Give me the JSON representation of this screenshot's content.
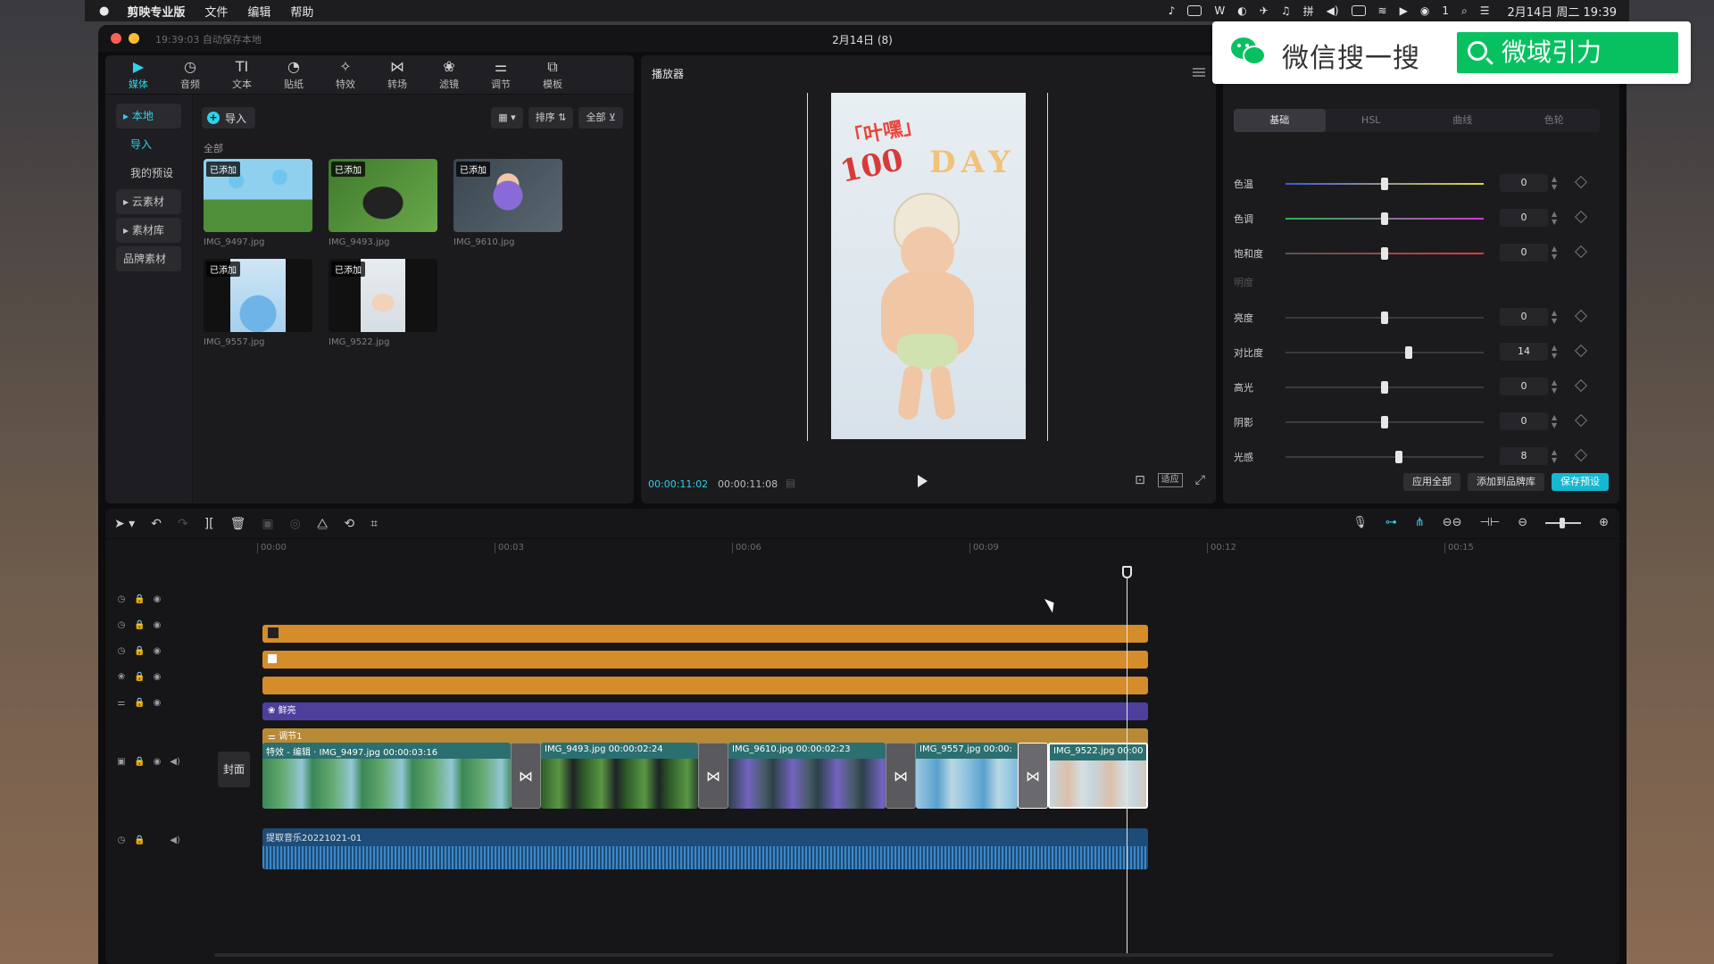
{
  "menubar": {
    "app_name": "剪映专业版",
    "menus": [
      "文件",
      "编辑",
      "帮助"
    ],
    "notif_count": "1",
    "datetime": "2月14日 周二  19:39"
  },
  "window": {
    "autosave": "19:39:03 自动保存本地",
    "title": "2月14日 (8)"
  },
  "toolbar": {
    "items": [
      {
        "label": "媒体",
        "icon": "media-icon"
      },
      {
        "label": "音频",
        "icon": "audio-icon"
      },
      {
        "label": "文本",
        "icon": "text-icon"
      },
      {
        "label": "贴纸",
        "icon": "sticker-icon"
      },
      {
        "label": "特效",
        "icon": "effects-icon"
      },
      {
        "label": "转场",
        "icon": "transition-icon"
      },
      {
        "label": "滤镜",
        "icon": "filter-icon"
      },
      {
        "label": "调节",
        "icon": "adjust-icon"
      },
      {
        "label": "模板",
        "icon": "template-icon"
      }
    ]
  },
  "sidebar": {
    "items": [
      "本地",
      "导入",
      "我的预设",
      "云素材",
      "素材库",
      "品牌素材"
    ]
  },
  "media": {
    "import_label": "导入",
    "sort_label": "排序",
    "filter_label": "全部",
    "section_label": "全部",
    "added_badge": "已添加",
    "files": [
      "IMG_9497.jpg",
      "IMG_9493.jpg",
      "IMG_9610.jpg",
      "IMG_9557.jpg",
      "IMG_9522.jpg"
    ]
  },
  "player": {
    "title": "播放器",
    "current_time": "00:00:11:02",
    "total_time": "00:00:11:08",
    "fit_label": "适应",
    "photo_text_1": "「叶嘿」",
    "photo_text_2": "100",
    "photo_text_3": "DAY"
  },
  "adjust": {
    "tabs": [
      "基础",
      "HSL",
      "曲线",
      "色轮"
    ],
    "sliders": [
      {
        "label": "色温",
        "value": "0",
        "level": 0.5
      },
      {
        "label": "色调",
        "value": "0",
        "level": 0.5
      },
      {
        "label": "饱和度",
        "value": "0",
        "level": 0.5
      },
      {
        "label": "亮度",
        "value": "0",
        "level": 0.5
      },
      {
        "label": "对比度",
        "value": "14",
        "level": 0.62
      },
      {
        "label": "高光",
        "value": "0",
        "level": 0.5
      },
      {
        "label": "阴影",
        "value": "0",
        "level": 0.5
      },
      {
        "label": "光感",
        "value": "8",
        "level": 0.57
      }
    ],
    "section_brightness": "明度",
    "apply_all": "应用全部",
    "add_brand": "添加到品牌库",
    "save_preset": "保存预设"
  },
  "wechat": {
    "search_text": "微信搜一搜",
    "button_text": "微域引力"
  },
  "timeline": {
    "ticks": [
      "00:00",
      "00:03",
      "00:06",
      "00:09",
      "00:12",
      "00:15"
    ],
    "clip_vivid": "鲜亮",
    "clip_adjust": "调节1",
    "cover_label": "封面",
    "video_clips": [
      {
        "label": "特效 - 编辑 · IMG_9497.jpg  00:00:03:16"
      },
      {
        "label": "IMG_9493.jpg  00:00:02:24"
      },
      {
        "label": "IMG_9610.jpg  00:00:02:23"
      },
      {
        "label": "IMG_9557.jpg  00:00:"
      },
      {
        "label": "IMG_9522.jpg  00:00"
      }
    ],
    "audio_label": "提取音乐20221021-01"
  }
}
